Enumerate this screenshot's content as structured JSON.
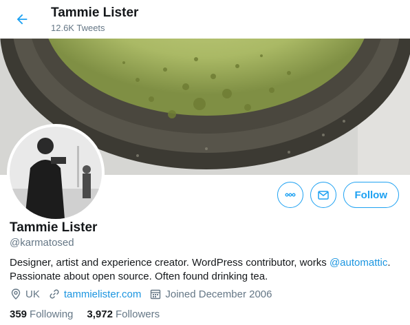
{
  "header": {
    "title": "Tammie Lister",
    "tweet_count": "12.6K Tweets"
  },
  "profile": {
    "name": "Tammie Lister",
    "handle": "@karmatosed",
    "bio_text": "Designer, artist and experience creator. WordPress contributor, works ",
    "bio_mention": "@automattic",
    "bio_text_2": ". Passionate about open source. Often found drinking tea.",
    "location": "UK",
    "website": "tammielister.com",
    "joined": "Joined December 2006"
  },
  "actions": {
    "follow_label": "Follow"
  },
  "stats": {
    "following_count": "359",
    "following_label": "Following",
    "followers_count": "3,972",
    "followers_label": "Followers"
  },
  "colors": {
    "accent": "#1da1f2",
    "muted": "#657786",
    "text": "#14171a"
  },
  "icons": [
    "back-arrow-icon",
    "more-icon",
    "mail-icon",
    "location-icon",
    "link-icon",
    "calendar-icon"
  ]
}
